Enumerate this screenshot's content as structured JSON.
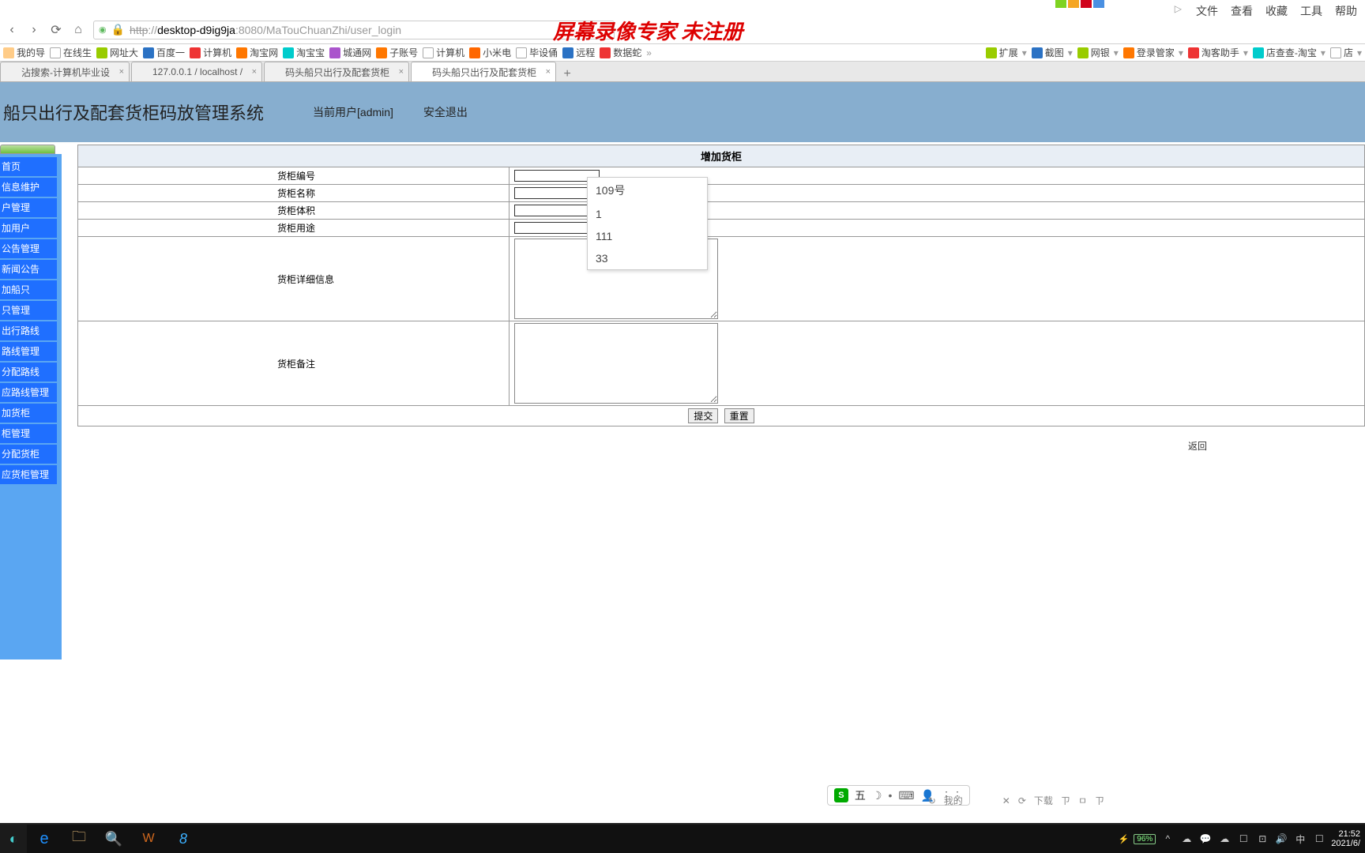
{
  "win_colors": [
    "#7ed321",
    "#f5a623",
    "#d0021b",
    "#4a90e2"
  ],
  "top_menu": [
    "文件",
    "查看",
    "收藏",
    "工具",
    "帮助"
  ],
  "nav": {
    "back": "‹",
    "fwd": "›",
    "reload": "⟳",
    "home": "⌂"
  },
  "url": {
    "scheme": "http",
    "scheme_strike": "://",
    "host": "desktop-d9ig9ja",
    "port": ":8080",
    "path": "/MaTouChuanZhi/user_login"
  },
  "watermark": "屏幕录像专家  未注册",
  "bookmarks_left": [
    {
      "ic": "ic-folder",
      "t": "我的导"
    },
    {
      "ic": "ic-page",
      "t": "在线生"
    },
    {
      "ic": "ic-green",
      "t": "网址大"
    },
    {
      "ic": "ic-blue",
      "t": "百度一"
    },
    {
      "ic": "ic-red",
      "t": "计算机"
    },
    {
      "ic": "ic-orange",
      "t": "淘宝网"
    },
    {
      "ic": "ic-cyan",
      "t": "淘宝宝"
    },
    {
      "ic": "ic-purple",
      "t": "城通网"
    },
    {
      "ic": "ic-orange",
      "t": "子账号"
    },
    {
      "ic": "ic-page",
      "t": "计算机"
    },
    {
      "ic": "ic-xm",
      "t": "小米电"
    },
    {
      "ic": "ic-page",
      "t": "毕设俑"
    },
    {
      "ic": "ic-blue",
      "t": "远程"
    },
    {
      "ic": "ic-red",
      "t": "数据蛇"
    }
  ],
  "bm_more": "»",
  "bookmarks_right": [
    {
      "ic": "ic-green",
      "t": "扩展"
    },
    {
      "ic": "ic-blue",
      "t": "截图"
    },
    {
      "ic": "ic-green",
      "t": "网银"
    },
    {
      "ic": "ic-orange",
      "t": "登录管家"
    },
    {
      "ic": "ic-red",
      "t": "淘客助手"
    },
    {
      "ic": "ic-cyan",
      "t": "店查查-淘宝"
    },
    {
      "ic": "ic-page",
      "t": "店"
    }
  ],
  "tabs": [
    {
      "t": "沾搜索-计算机毕业设",
      "active": false
    },
    {
      "t": "127.0.0.1 / localhost /",
      "active": false
    },
    {
      "t": "码头船只出行及配套货柜",
      "active": false
    },
    {
      "t": "码头船只出行及配套货柜",
      "active": true
    }
  ],
  "newtab": "+",
  "app": {
    "title": "船只出行及配套货柜码放管理系统",
    "user": "当前用户[admin]",
    "logout": "安全退出"
  },
  "sidebar": [
    "首页",
    "信息维护",
    "户管理",
    "加用户",
    "公告管理",
    "新闻公告",
    "加船只",
    "只管理",
    "出行路线",
    "路线管理",
    "分配路线",
    "应路线管理",
    "加货柜",
    "柜管理",
    "分配货柜",
    "应货柜管理"
  ],
  "form": {
    "title": "增加货柜",
    "rows": [
      {
        "label": "货柜编号",
        "type": "text"
      },
      {
        "label": "货柜名称",
        "type": "text"
      },
      {
        "label": "货柜体积",
        "type": "text"
      },
      {
        "label": "货柜用途",
        "type": "text"
      },
      {
        "label": "货柜详细信息",
        "type": "textarea"
      },
      {
        "label": "货柜备注",
        "type": "textarea"
      }
    ],
    "submit": "提交",
    "reset": "重置",
    "back": "返回"
  },
  "autocomplete": [
    "109号",
    "1",
    "111",
    "33"
  ],
  "ime": {
    "logo": "S",
    "label": "五",
    "moon": "☽",
    "dot": "•",
    "kb": "⌨",
    "person": "👤",
    "grid": "⋮⋮"
  },
  "dl": {
    "label": "我的",
    "dl": "下载",
    "p1": "ㄗ",
    "p2": "ㅁ",
    "p3": "ㄗ"
  },
  "taskbar": {
    "battery": "96%",
    "tray": [
      "^",
      "☁",
      "💬",
      "☁",
      "☐",
      "⊡",
      "🔊",
      "中",
      "☐"
    ],
    "time": "21:52",
    "date": "2021/6/"
  }
}
